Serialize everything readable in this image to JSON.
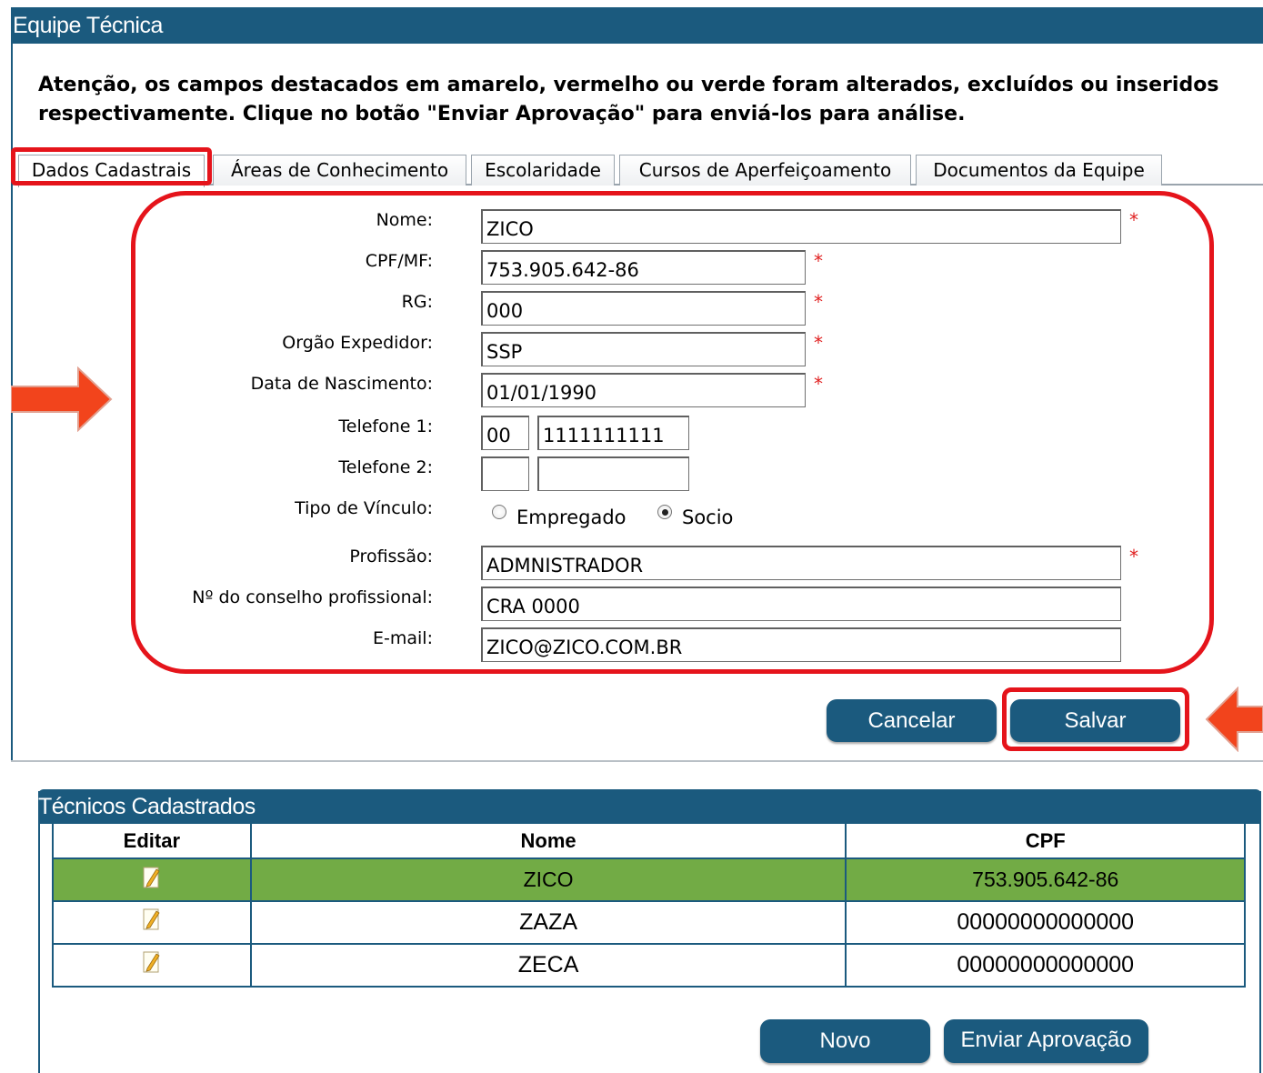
{
  "window": {
    "title": "Equipe Técnica"
  },
  "notice": "Atenção, os campos destacados em amarelo, vermelho ou verde foram alterados, excluídos ou inseridos respectivamente. Clique no botão \"Enviar Aprovação\" para enviá-los para análise.",
  "tabs": [
    {
      "label": "Dados Cadastrais",
      "active": true
    },
    {
      "label": "Áreas de Conhecimento"
    },
    {
      "label": "Escolaridade"
    },
    {
      "label": "Cursos de Aperfeiçoamento"
    },
    {
      "label": "Documentos da Equipe"
    }
  ],
  "form": {
    "nome": {
      "label": "Nome:",
      "value": "ZICO",
      "required": "*"
    },
    "cpf": {
      "label": "CPF/MF:",
      "value": "753.905.642-86",
      "required": "*"
    },
    "rg": {
      "label": "RG:",
      "value": "000",
      "required": "*"
    },
    "orgao": {
      "label": "Orgão Expedidor:",
      "value": "SSP",
      "required": "*"
    },
    "nascimento": {
      "label": "Data de Nascimento:",
      "value": "01/01/1990",
      "required": "*"
    },
    "telefone1": {
      "label": "Telefone 1:",
      "ddd": "00",
      "numero": "1111111111"
    },
    "telefone2": {
      "label": "Telefone 2:",
      "ddd": "",
      "numero": ""
    },
    "vinculo": {
      "label": "Tipo de Vínculo:",
      "options": [
        {
          "label": "Empregado",
          "checked": false
        },
        {
          "label": "Socio",
          "checked": true
        }
      ]
    },
    "profissao": {
      "label": "Profissão:",
      "value": "ADMNISTRADOR",
      "required": "*"
    },
    "conselho": {
      "label": "Nº do conselho profissional:",
      "value": "CRA 0000"
    },
    "email": {
      "label": "E-mail:",
      "value": "ZICO@ZICO.COM.BR"
    }
  },
  "buttons": {
    "cancelar": "Cancelar",
    "salvar": "Salvar",
    "novo": "Novo",
    "enviar": "Enviar Aprovação"
  },
  "grid": {
    "title": "Técnicos Cadastrados",
    "columns": [
      "Editar",
      "Nome",
      "CPF"
    ],
    "rows": [
      {
        "nome": "ZICO",
        "cpf": "753.905.642-86",
        "selected": true
      },
      {
        "nome": "ZAZA",
        "cpf": "00000000000000"
      },
      {
        "nome": "ZECA",
        "cpf": "00000000000000"
      }
    ]
  },
  "colors": {
    "header": "#1b5a7e",
    "highlight": "#e5141b",
    "arrow": "#f2441c",
    "selected_row": "#72ab45",
    "required": "#e02020"
  },
  "icons": [
    "edit-icon",
    "arrow-right-icon",
    "arrow-left-icon"
  ]
}
